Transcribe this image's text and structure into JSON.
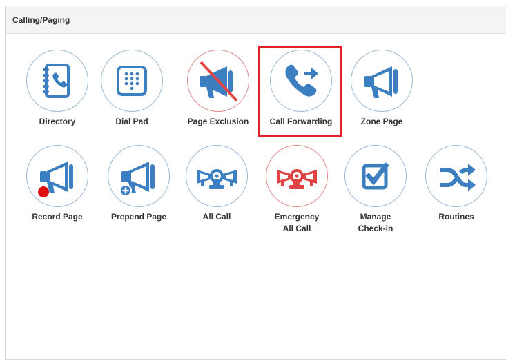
{
  "panel": {
    "title": "Calling/Paging"
  },
  "tiles": [
    {
      "label": "Directory",
      "icon": "directory-icon"
    },
    {
      "label": "Dial Pad",
      "icon": "dialpad-icon"
    },
    {
      "label": "Page Exclusion",
      "icon": "page-exclusion-icon"
    },
    {
      "label": "Call Forwarding",
      "icon": "call-forwarding-icon"
    },
    {
      "label": "Zone Page",
      "icon": "megaphone-icon"
    },
    {
      "label": "Record Page",
      "icon": "record-page-icon"
    },
    {
      "label": "Prepend Page",
      "icon": "prepend-page-icon"
    },
    {
      "label": "All Call",
      "icon": "all-call-icon"
    },
    {
      "label_line1": "Emergency",
      "label_line2": "All Call",
      "icon": "emergency-all-call-icon"
    },
    {
      "label_line1": "Manage",
      "label_line2": "Check-in",
      "icon": "checkbox-icon"
    },
    {
      "label": "Routines",
      "icon": "shuffle-icon"
    }
  ],
  "selected": "Call Forwarding",
  "colors": {
    "icon_blue": "#3c7fc1",
    "emergency_red": "#e04545",
    "selection_red": "#e3202a"
  }
}
